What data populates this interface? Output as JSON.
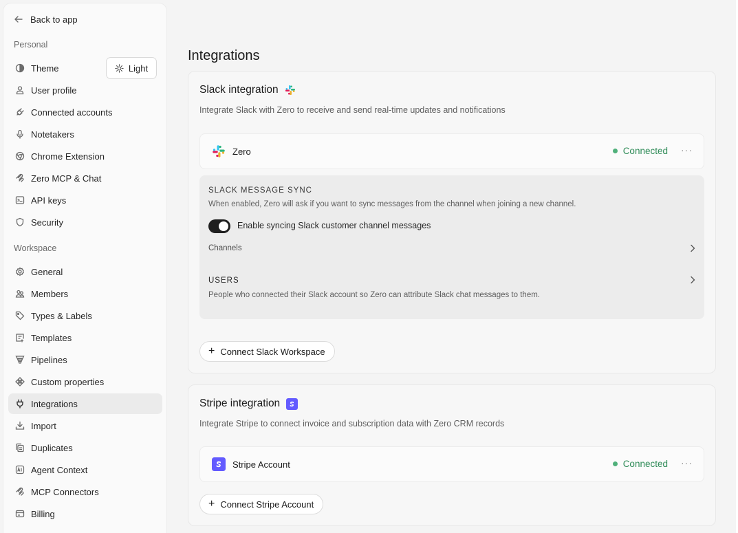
{
  "sidebar": {
    "back_label": "Back to app",
    "personal_label": "Personal",
    "workspace_label": "Workspace",
    "theme_value": "Light",
    "personal_items": [
      {
        "label": "Theme"
      },
      {
        "label": "User profile"
      },
      {
        "label": "Connected accounts"
      },
      {
        "label": "Notetakers"
      },
      {
        "label": "Chrome Extension"
      },
      {
        "label": "Zero MCP & Chat"
      },
      {
        "label": "API keys"
      },
      {
        "label": "Security"
      }
    ],
    "workspace_items": [
      {
        "label": "General"
      },
      {
        "label": "Members"
      },
      {
        "label": "Types & Labels"
      },
      {
        "label": "Templates"
      },
      {
        "label": "Pipelines"
      },
      {
        "label": "Custom properties"
      },
      {
        "label": "Integrations"
      },
      {
        "label": "Import"
      },
      {
        "label": "Duplicates"
      },
      {
        "label": "Agent Context"
      },
      {
        "label": "MCP Connectors"
      },
      {
        "label": "Billing"
      }
    ]
  },
  "main": {
    "title": "Integrations",
    "slack": {
      "title": "Slack integration",
      "description": "Integrate Slack with Zero to receive and send real-time updates and notifications",
      "account_name": "Zero",
      "status": "Connected",
      "more": "···",
      "sync_title": "SLACK MESSAGE SYNC",
      "sync_desc": "When enabled, Zero will ask if you want to sync messages from the channel when joining a new channel.",
      "toggle_label": "Enable syncing Slack customer channel messages",
      "toggle_on": true,
      "channels_label": "Channels",
      "users_title": "USERS",
      "users_desc": "People who connected their Slack account so Zero can attribute Slack chat messages to them.",
      "connect_label": "Connect Slack Workspace"
    },
    "stripe": {
      "title": "Stripe integration",
      "description": "Integrate Stripe to connect invoice and subscription data with Zero CRM records",
      "account_name": "Stripe Account",
      "status": "Connected",
      "more": "···",
      "connect_label": "Connect Stripe Account"
    }
  },
  "colors": {
    "connected": "#2e8b57",
    "stripe": "#635bff",
    "active_nav": "#ebebeb"
  }
}
